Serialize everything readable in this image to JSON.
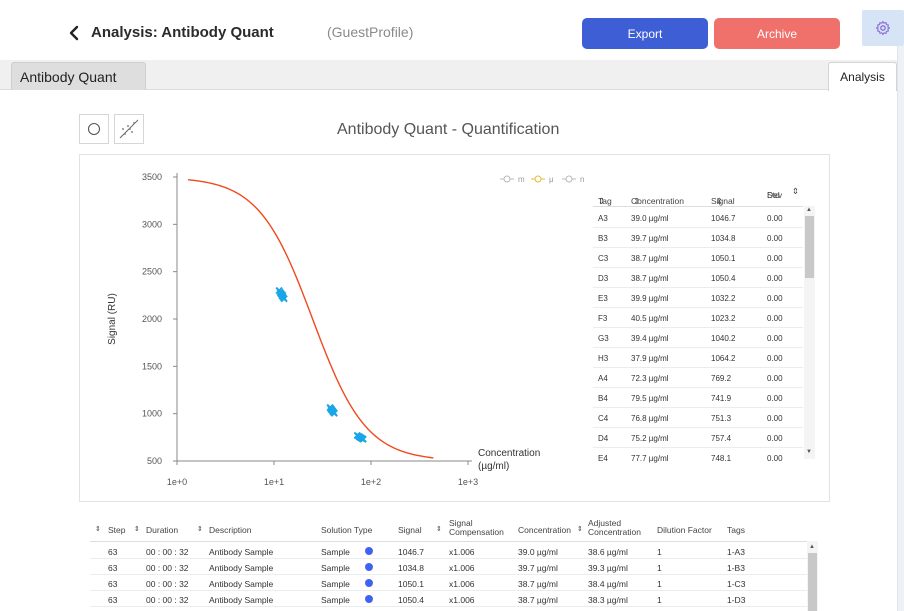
{
  "header": {
    "title": "Analysis: Antibody Quant",
    "profile": "(GuestProfile)",
    "export_label": "Export",
    "archive_label": "Archive"
  },
  "tabs": {
    "left": "Antibody Quant",
    "right": "Analysis"
  },
  "chart_title": "Antibody Quant - Quantification",
  "legend": [
    "m",
    "μ",
    "n"
  ],
  "colors": {
    "curve": "#f04a1e",
    "points": "#1aa6e6",
    "export": "#3e5ed6",
    "archive": "#f0706b",
    "legend_mu": "#e8b830"
  },
  "chart_data": {
    "type": "scatter",
    "title": "Antibody Quant - Quantification",
    "xlabel": "Concentration (µg/ml)",
    "ylabel": "Signal (RU)",
    "x_scale": "log",
    "x_ticks": [
      "1e+0",
      "1e+1",
      "1e+2",
      "1e+3"
    ],
    "y_ticks": [
      "500",
      "1000",
      "1500",
      "2000",
      "2500",
      "3000",
      "3500"
    ],
    "ylim": [
      500,
      3500
    ],
    "xlim": [
      1,
      1000
    ],
    "grid": false,
    "curve": {
      "model": "4PL",
      "top": 3500,
      "bottom": 500,
      "ec50": 25,
      "hill": 1.57,
      "x_range": [
        1.3,
        440
      ]
    },
    "points": [
      {
        "x": 11.3,
        "y": 2300
      },
      {
        "x": 11.6,
        "y": 2280
      },
      {
        "x": 11.9,
        "y": 2262
      },
      {
        "x": 12.1,
        "y": 2245
      },
      {
        "x": 12.4,
        "y": 2230
      },
      {
        "x": 12.7,
        "y": 2215
      },
      {
        "x": 11.8,
        "y": 2270
      },
      {
        "x": 12.3,
        "y": 2250
      },
      {
        "x": 37.9,
        "y": 1064.2
      },
      {
        "x": 38.7,
        "y": 1050.4
      },
      {
        "x": 38.7,
        "y": 1050.1
      },
      {
        "x": 39.0,
        "y": 1046.7
      },
      {
        "x": 39.4,
        "y": 1040.2
      },
      {
        "x": 39.7,
        "y": 1034.8
      },
      {
        "x": 39.9,
        "y": 1032.2
      },
      {
        "x": 40.5,
        "y": 1023.2
      },
      {
        "x": 41.0,
        "y": 1015
      },
      {
        "x": 41.8,
        "y": 1005
      },
      {
        "x": 72.3,
        "y": 769.2
      },
      {
        "x": 75.2,
        "y": 757.4
      },
      {
        "x": 76.8,
        "y": 751.3
      },
      {
        "x": 77.7,
        "y": 748.1
      },
      {
        "x": 79.5,
        "y": 741.9
      },
      {
        "x": 81.0,
        "y": 736
      },
      {
        "x": 83.0,
        "y": 731
      }
    ]
  },
  "side_table": {
    "headers": [
      "Tag",
      "Concentration",
      "Signal",
      "Std Dev"
    ],
    "std_dev_line1": "Std",
    "std_dev_line2": "Dev",
    "rows": [
      [
        "A3",
        "39.0 µg/ml",
        "1046.7",
        "0.00"
      ],
      [
        "B3",
        "39.7 µg/ml",
        "1034.8",
        "0.00"
      ],
      [
        "C3",
        "38.7 µg/ml",
        "1050.1",
        "0.00"
      ],
      [
        "D3",
        "38.7 µg/ml",
        "1050.4",
        "0.00"
      ],
      [
        "E3",
        "39.9 µg/ml",
        "1032.2",
        "0.00"
      ],
      [
        "F3",
        "40.5 µg/ml",
        "1023.2",
        "0.00"
      ],
      [
        "G3",
        "39.4 µg/ml",
        "1040.2",
        "0.00"
      ],
      [
        "H3",
        "37.9 µg/ml",
        "1064.2",
        "0.00"
      ],
      [
        "A4",
        "72.3 µg/ml",
        "769.2",
        "0.00"
      ],
      [
        "B4",
        "79.5 µg/ml",
        "741.9",
        "0.00"
      ],
      [
        "C4",
        "76.8 µg/ml",
        "751.3",
        "0.00"
      ],
      [
        "D4",
        "75.2 µg/ml",
        "757.4",
        "0.00"
      ],
      [
        "E4",
        "77.7 µg/ml",
        "748.1",
        "0.00"
      ]
    ]
  },
  "bottom_table": {
    "headers": {
      "step": "Step",
      "duration": "Duration",
      "description": "Description",
      "solution_type": "Solution Type",
      "signal": "Signal",
      "signal_comp_1": "Signal",
      "signal_comp_2": "Compensation",
      "concentration": "Concentration",
      "adj_conc_1": "Adjusted",
      "adj_conc_2": "Concentration",
      "dilution": "Dilution Factor",
      "tags": "Tags"
    },
    "rows": [
      {
        "step": "63",
        "duration": "00 : 00 : 32",
        "description": "Antibody Sample",
        "solution": "Sample",
        "signal": "1046.7",
        "comp": "x1.006",
        "conc": "39.0  µg/ml",
        "adj": "38.6  µg/ml",
        "dilution": "1",
        "tag": "1-A3"
      },
      {
        "step": "63",
        "duration": "00 : 00 : 32",
        "description": "Antibody Sample",
        "solution": "Sample",
        "signal": "1034.8",
        "comp": "x1.006",
        "conc": "39.7  µg/ml",
        "adj": "39.3  µg/ml",
        "dilution": "1",
        "tag": "1-B3"
      },
      {
        "step": "63",
        "duration": "00 : 00 : 32",
        "description": "Antibody Sample",
        "solution": "Sample",
        "signal": "1050.1",
        "comp": "x1.006",
        "conc": "38.7  µg/ml",
        "adj": "38.4  µg/ml",
        "dilution": "1",
        "tag": "1-C3"
      },
      {
        "step": "63",
        "duration": "00 : 00 : 32",
        "description": "Antibody Sample",
        "solution": "Sample",
        "signal": "1050.4",
        "comp": "x1.006",
        "conc": "38.7  µg/ml",
        "adj": "38.3  µg/ml",
        "dilution": "1",
        "tag": "1-D3"
      }
    ]
  }
}
